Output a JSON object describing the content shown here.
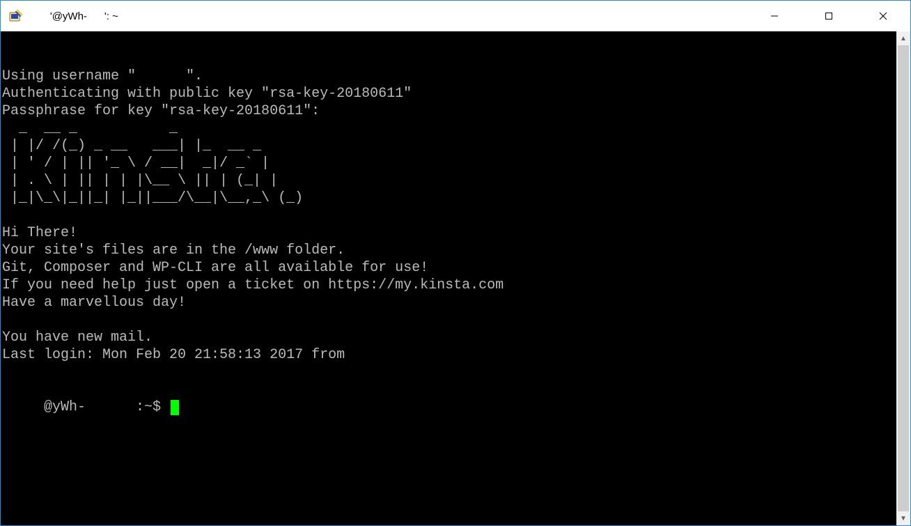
{
  "window": {
    "title": "     '@yWh-      ': ~"
  },
  "terminal": {
    "lines": [
      "Using username \"      \".",
      "Authenticating with public key \"rsa-key-20180611\"",
      "Passphrase for key \"rsa-key-20180611\":",
      "  _  __ _           _",
      " | |/ /(_) _ __   ___| |_  __ _",
      " | ' / | || '_ \\ / __|  _|/ _` |",
      " | . \\ | || | | |\\__ \\ || | (_| |",
      " |_|\\_\\|_||_| |_||___/\\__|\\__,_\\ (_)",
      "",
      "Hi There!",
      "Your site's files are in the /www folder.",
      "Git, Composer and WP-CLI are all available for use!",
      "If you need help just open a ticket on https://my.kinsta.com",
      "Have a marvellous day!",
      "",
      "You have new mail.",
      "Last login: Mon Feb 20 21:58:13 2017 from"
    ],
    "prompt": "     @yWh-      :~$ "
  }
}
